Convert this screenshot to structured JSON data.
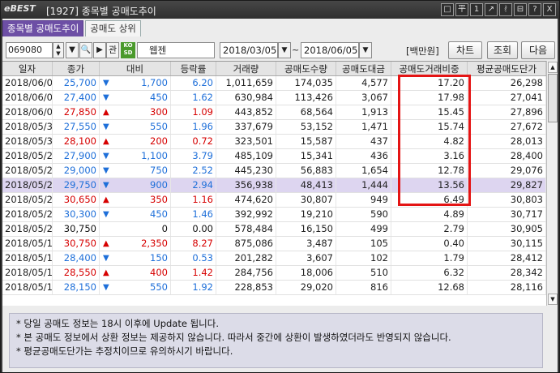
{
  "window": {
    "logo": "eBEST",
    "title": "[1927] 종목별 공매도추이",
    "buttons": [
      "□",
      "平",
      "1",
      "↗",
      "ᚯ",
      "⊟",
      "?",
      "X"
    ]
  },
  "tabs": [
    {
      "label": "종목별 공매도추이",
      "active": true
    },
    {
      "label": "공매도 상위",
      "active": false
    }
  ],
  "toolbar": {
    "code": "069080",
    "related_label": "관",
    "badge": "코스닥",
    "name": "웹젠",
    "date_from": "2018/03/05",
    "date_to": "2018/06/05",
    "tilde": "~",
    "unit": "[백만원]",
    "chart_btn": "차트",
    "query_btn": "조회",
    "next_btn": "다음"
  },
  "table": {
    "columns": [
      "일자",
      "종가",
      "대비",
      "등락률",
      "거래량",
      "공매도수량",
      "공매도대금",
      "공매도거래비중",
      "평균공매도단가"
    ],
    "rows": [
      {
        "date": "2018/06/05",
        "close": "25,700",
        "dir": "dn",
        "change": "1,700",
        "rate": "6.20",
        "volume": "1,011,659",
        "short_qty": "174,035",
        "short_amt": "4,577",
        "ratio": "17.20",
        "avg": "26,298"
      },
      {
        "date": "2018/06/04",
        "close": "27,400",
        "dir": "dn",
        "change": "450",
        "rate": "1.62",
        "volume": "630,984",
        "short_qty": "113,426",
        "short_amt": "3,067",
        "ratio": "17.98",
        "avg": "27,041"
      },
      {
        "date": "2018/06/01",
        "close": "27,850",
        "dir": "up",
        "change": "300",
        "rate": "1.09",
        "volume": "443,852",
        "short_qty": "68,564",
        "short_amt": "1,913",
        "ratio": "15.45",
        "avg": "27,896"
      },
      {
        "date": "2018/05/31",
        "close": "27,550",
        "dir": "dn",
        "change": "550",
        "rate": "1.96",
        "volume": "337,679",
        "short_qty": "53,152",
        "short_amt": "1,471",
        "ratio": "15.74",
        "avg": "27,672"
      },
      {
        "date": "2018/05/30",
        "close": "28,100",
        "dir": "up",
        "change": "200",
        "rate": "0.72",
        "volume": "323,501",
        "short_qty": "15,587",
        "short_amt": "437",
        "ratio": "4.82",
        "avg": "28,013"
      },
      {
        "date": "2018/05/29",
        "close": "27,900",
        "dir": "dn",
        "change": "1,100",
        "rate": "3.79",
        "volume": "485,109",
        "short_qty": "15,341",
        "short_amt": "436",
        "ratio": "3.16",
        "avg": "28,400"
      },
      {
        "date": "2018/05/28",
        "close": "29,000",
        "dir": "dn",
        "change": "750",
        "rate": "2.52",
        "volume": "445,230",
        "short_qty": "56,883",
        "short_amt": "1,654",
        "ratio": "12.78",
        "avg": "29,076"
      },
      {
        "date": "2018/05/25",
        "close": "29,750",
        "dir": "dn",
        "change": "900",
        "rate": "2.94",
        "volume": "356,938",
        "short_qty": "48,413",
        "short_amt": "1,444",
        "ratio": "13.56",
        "avg": "29,827",
        "selected": true
      },
      {
        "date": "2018/05/24",
        "close": "30,650",
        "dir": "up",
        "change": "350",
        "rate": "1.16",
        "volume": "474,620",
        "short_qty": "30,807",
        "short_amt": "949",
        "ratio": "6.49",
        "avg": "30,803"
      },
      {
        "date": "2018/05/23",
        "close": "30,300",
        "dir": "dn",
        "change": "450",
        "rate": "1.46",
        "volume": "392,992",
        "short_qty": "19,210",
        "short_amt": "590",
        "ratio": "4.89",
        "avg": "30,717"
      },
      {
        "date": "2018/05/21",
        "close": "30,750",
        "dir": "flat",
        "change": "0",
        "rate": "0.00",
        "volume": "578,484",
        "short_qty": "16,150",
        "short_amt": "499",
        "ratio": "2.79",
        "avg": "30,905"
      },
      {
        "date": "2018/05/18",
        "close": "30,750",
        "dir": "up",
        "change": "2,350",
        "rate": "8.27",
        "volume": "875,086",
        "short_qty": "3,487",
        "short_amt": "105",
        "ratio": "0.40",
        "avg": "30,115"
      },
      {
        "date": "2018/05/17",
        "close": "28,400",
        "dir": "dn",
        "change": "150",
        "rate": "0.53",
        "volume": "201,282",
        "short_qty": "3,607",
        "short_amt": "102",
        "ratio": "1.79",
        "avg": "28,412"
      },
      {
        "date": "2018/05/16",
        "close": "28,550",
        "dir": "up",
        "change": "400",
        "rate": "1.42",
        "volume": "284,756",
        "short_qty": "18,006",
        "short_amt": "510",
        "ratio": "6.32",
        "avg": "28,342"
      },
      {
        "date": "2018/05/15",
        "close": "28,150",
        "dir": "dn",
        "change": "550",
        "rate": "1.92",
        "volume": "228,853",
        "short_qty": "29,020",
        "short_amt": "816",
        "ratio": "12.68",
        "avg": "28,116"
      }
    ]
  },
  "notes": [
    "* 당일 공매도 정보는 18시 이후에 Update 됩니다.",
    "* 본 공매도 정보에서 상환 정보는 제공하지 않습니다. 따라서 중간에 상환이 발생하였더라도 반영되지 않습니다.",
    "* 평균공매도단가는 추정치이므로 유의하시기 바랍니다."
  ],
  "colors": {
    "up": "#d60000",
    "down": "#1e6fd9",
    "tab_active": "#6d4fa5",
    "highlight": "#e41414",
    "selected_row": "#ddd5f0"
  }
}
